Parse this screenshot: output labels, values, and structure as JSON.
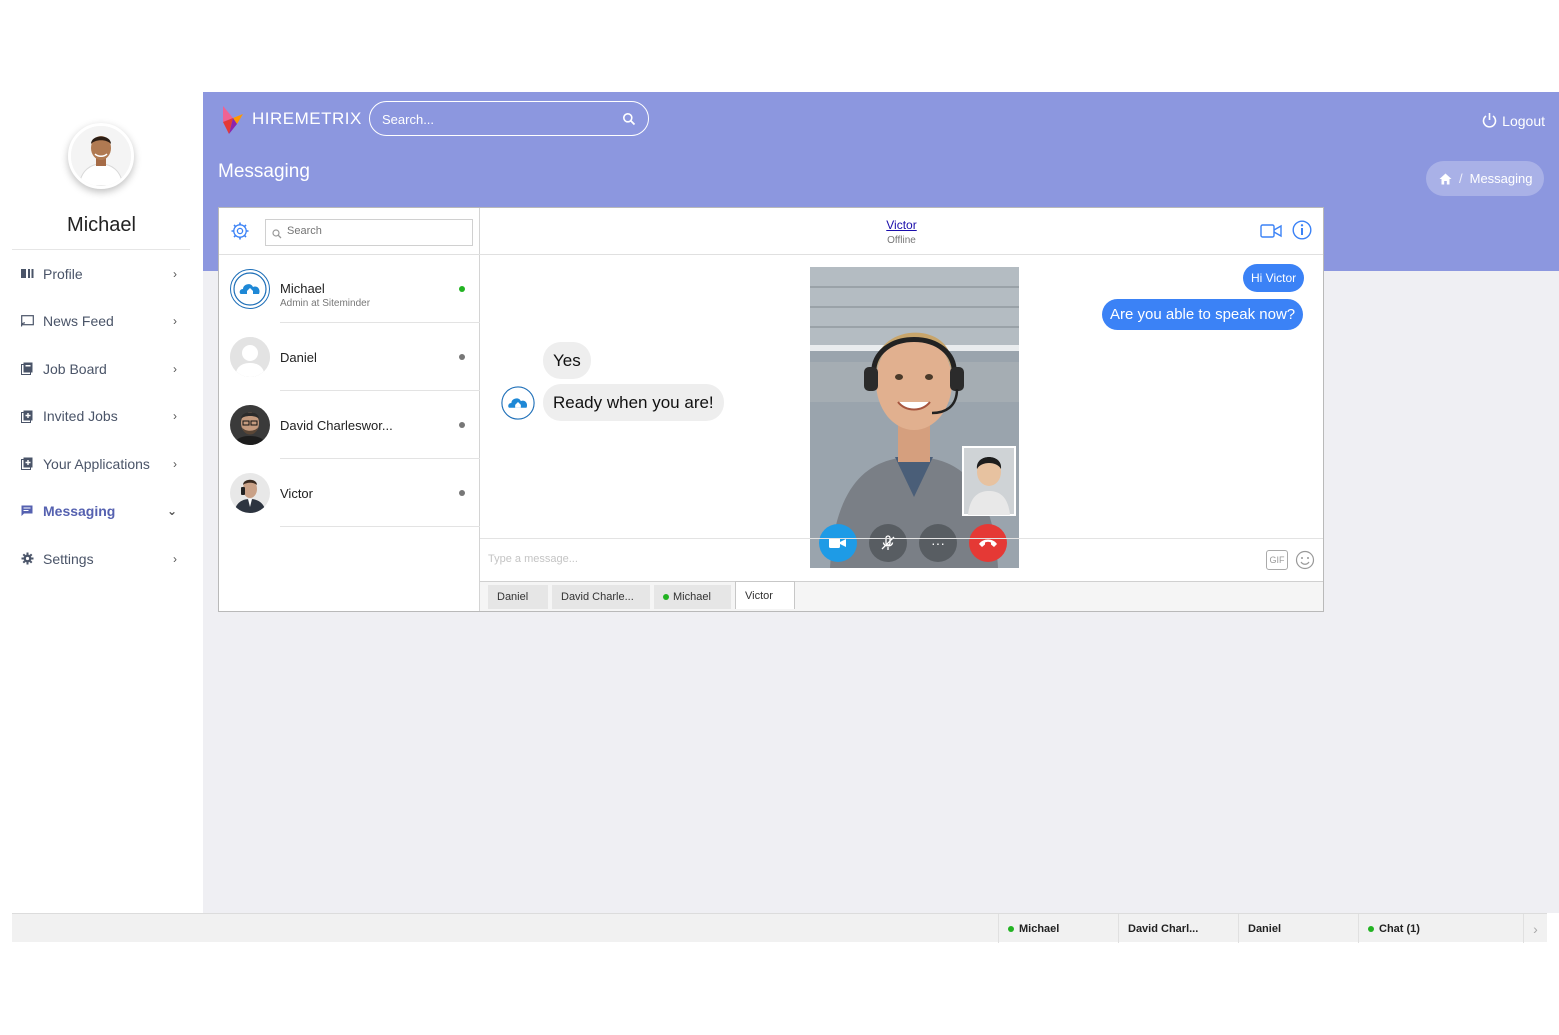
{
  "profile": {
    "name": "Michael"
  },
  "sidebar": {
    "items": [
      {
        "label": "Profile",
        "icon": "id-card-icon"
      },
      {
        "label": "News Feed",
        "icon": "cast-icon"
      },
      {
        "label": "Job Board",
        "icon": "book-icon"
      },
      {
        "label": "Invited Jobs",
        "icon": "book-plus-icon"
      },
      {
        "label": "Your Applications",
        "icon": "book-plus-icon"
      },
      {
        "label": "Messaging",
        "icon": "message-icon"
      },
      {
        "label": "Settings",
        "icon": "gear-icon"
      }
    ]
  },
  "header": {
    "brand": "HIREMETRIX",
    "search_placeholder": "Search...",
    "logout": "Logout"
  },
  "page": {
    "title": "Messaging",
    "breadcrumb": "Messaging"
  },
  "chat": {
    "contact_search_placeholder": "Search",
    "contacts": [
      {
        "name": "Michael",
        "subtitle": "Admin at Siteminder",
        "online": true
      },
      {
        "name": "Daniel",
        "subtitle": "",
        "online": false
      },
      {
        "name": "David Charleswor...",
        "subtitle": "",
        "online": false
      },
      {
        "name": "Victor",
        "subtitle": "",
        "online": false
      }
    ],
    "conversation": {
      "name": "Victor",
      "status": "Offline",
      "outgoing": [
        "Hi Victor",
        "Are you able to speak now?"
      ],
      "incoming": [
        "Yes",
        "Ready when you are!"
      ]
    },
    "compose_placeholder": "Type a message...",
    "gif_label": "GIF",
    "tabs": [
      {
        "label": "Daniel",
        "online": false
      },
      {
        "label": "David Charle...",
        "online": false
      },
      {
        "label": "Michael",
        "online": true
      },
      {
        "label": "Victor",
        "online": false
      }
    ]
  },
  "bottom_bar": {
    "items": [
      {
        "label": "Michael",
        "online": true
      },
      {
        "label": "David Charl...",
        "online": false
      },
      {
        "label": "Daniel",
        "online": false
      },
      {
        "label": "Chat (1)",
        "online": true
      }
    ]
  },
  "colors": {
    "header": "#8c97df",
    "accent": "#5561b0",
    "bubble_out": "#3b82f6",
    "hangup": "#e53935",
    "video_on": "#1e9be6",
    "online": "#22b322"
  }
}
